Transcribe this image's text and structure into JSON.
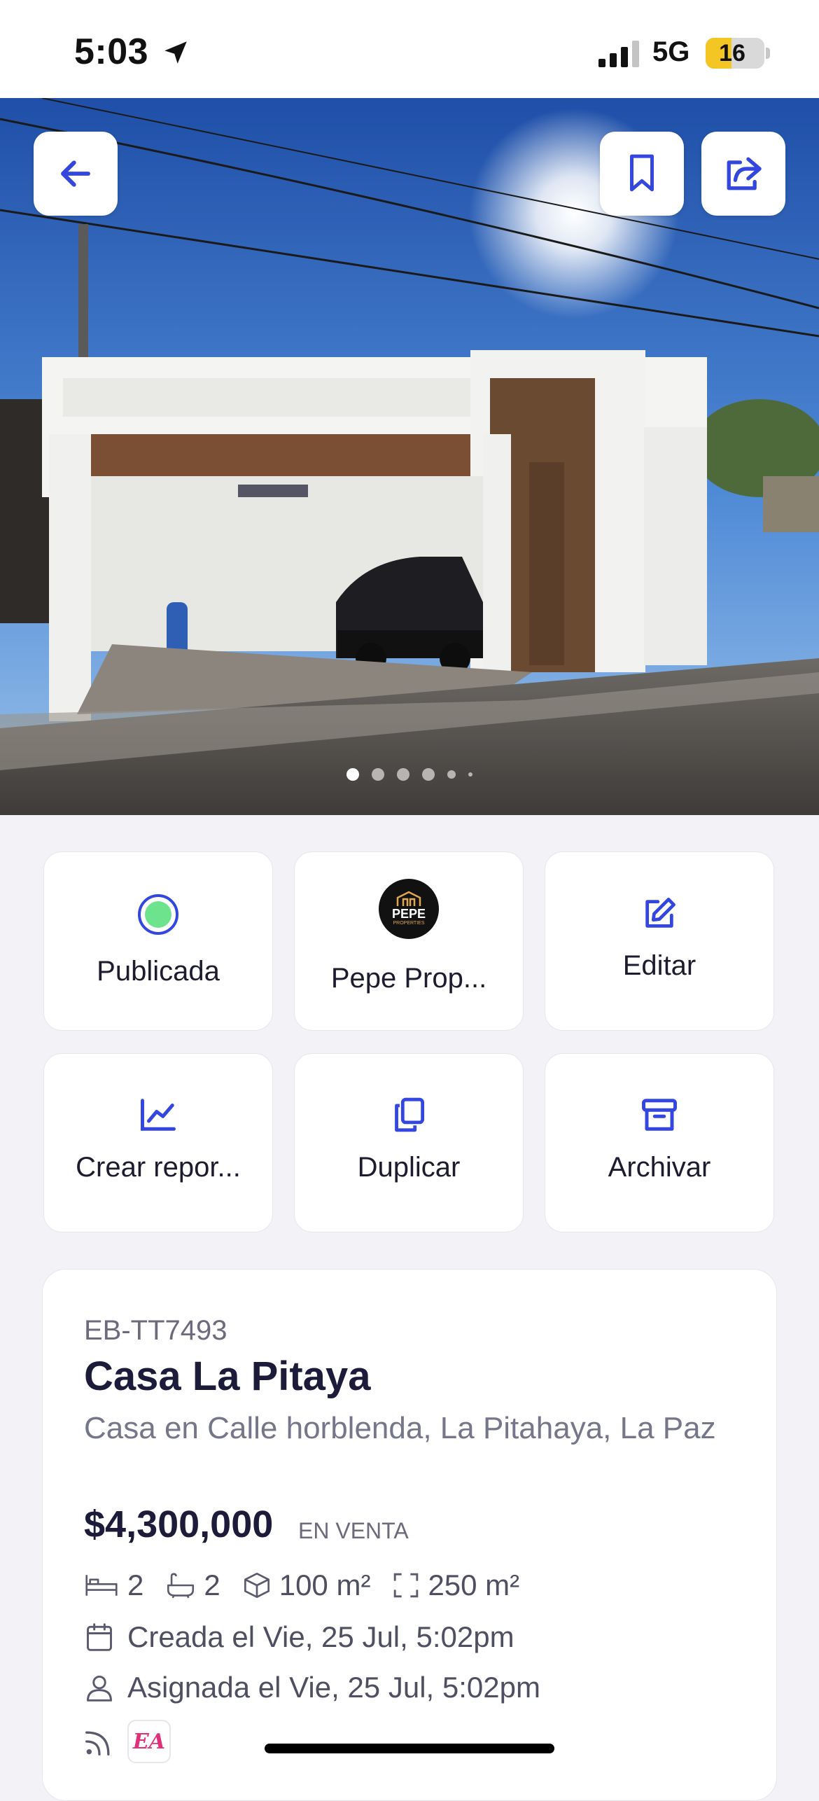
{
  "status_bar": {
    "time": "5:03",
    "network": "5G",
    "battery_level": "16",
    "battery_fill_fraction": 0.16,
    "battery_color": "#f3c623"
  },
  "gallery": {
    "photo_count_dots": 6,
    "active_index": 0,
    "buttons": {
      "back_icon": "arrow-left-icon",
      "bookmark_icon": "bookmark-icon",
      "share_icon": "share-icon"
    },
    "accent_color": "#3346e0"
  },
  "actions": [
    {
      "label": "Publicada",
      "icon": "status-dot-icon"
    },
    {
      "label": "Pepe Prop...",
      "icon": "agency-logo"
    },
    {
      "label": "Editar",
      "icon": "edit-icon"
    },
    {
      "label": "Crear repor...",
      "icon": "chart-icon"
    },
    {
      "label": "Duplicar",
      "icon": "duplicate-icon"
    },
    {
      "label": "Archivar",
      "icon": "archive-icon"
    }
  ],
  "agency_logo": {
    "text": "PEPE",
    "subtext": "PROPERTIES"
  },
  "listing": {
    "code": "EB-TT7493",
    "title": "Casa La Pitaya",
    "address": "Casa en Calle horblenda, La Pitahaya, La Paz",
    "price": "$4,300,000",
    "status": "EN VENTA",
    "features": {
      "bedrooms": "2",
      "bathrooms": "2",
      "built_area": "100 m²",
      "lot_area": "250 m²"
    },
    "created": "Creada el Vie, 25 Jul, 5:02pm",
    "assigned": "Asignada el Vie, 25 Jul, 5:02pm",
    "badge_text": "EA"
  }
}
